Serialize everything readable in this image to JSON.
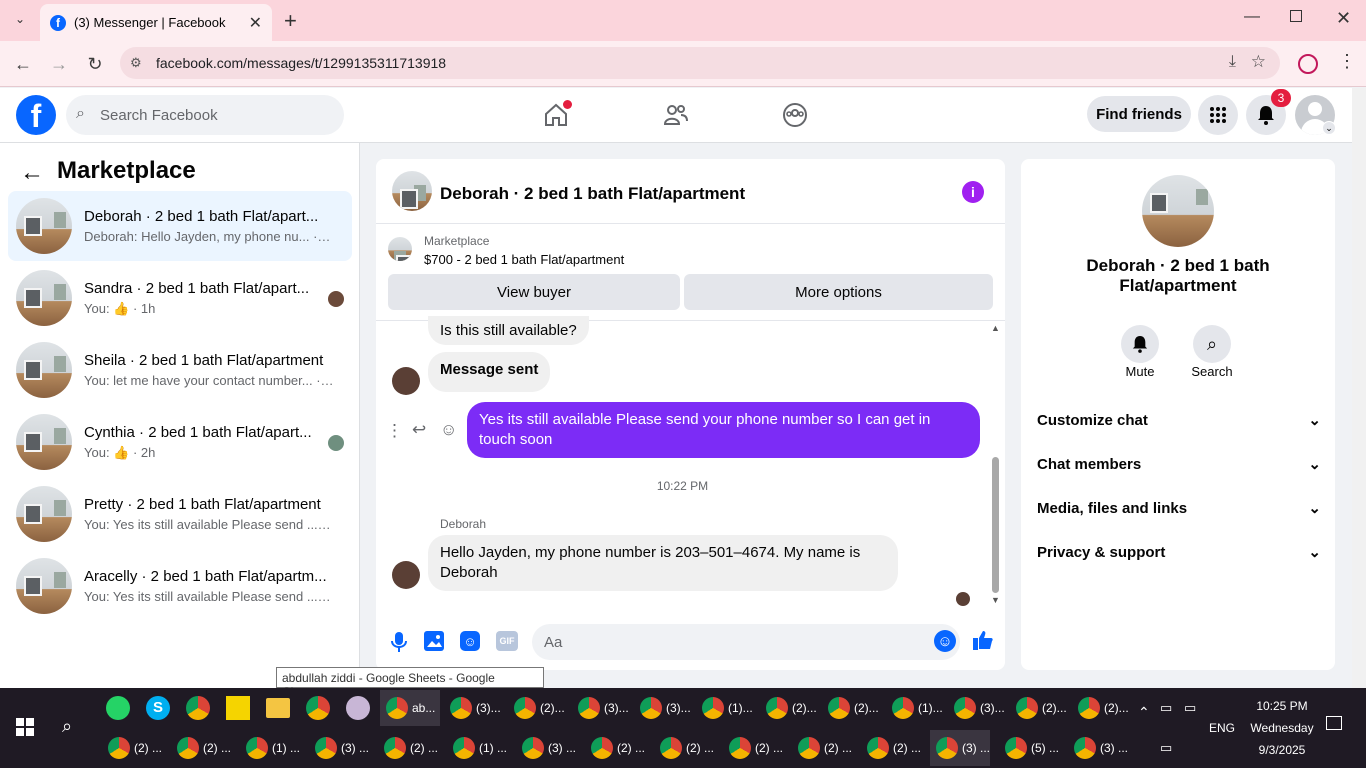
{
  "browser": {
    "tab_title": "(3) Messenger | Facebook",
    "url": "facebook.com/messages/t/1299135311713918"
  },
  "fb": {
    "search_placeholder": "Search Facebook",
    "find_friends": "Find friends",
    "notif_count": "3",
    "brand_color": "#0866ff"
  },
  "sidebar": {
    "title": "Marketplace",
    "conversations": [
      {
        "name": "Deborah · 2 bed 1 bath Flat/apart...",
        "preview": "Deborah: Hello Jayden, my phone nu... ·3m"
      },
      {
        "name": "Sandra · 2 bed 1 bath Flat/apart...",
        "preview": "You: 👍 · 1h"
      },
      {
        "name": "Sheila · 2 bed 1 bath Flat/apartment",
        "preview": "You: let me have your contact number... · 1h"
      },
      {
        "name": "Cynthia · 2 bed 1 bath Flat/apart...",
        "preview": "You: 👍 · 2h"
      },
      {
        "name": "Pretty · 2 bed 1 bath Flat/apartment",
        "preview": "You: Yes its still available Please send ... · 2h"
      },
      {
        "name": "Aracelly · 2 bed 1 bath Flat/apartm...",
        "preview": "You: Yes its still available Please send ... · 2h"
      }
    ]
  },
  "chat": {
    "title": "Deborah · 2 bed 1 bath Flat/apartment",
    "listing_label": "Marketplace",
    "listing_title": "$700 - 2 bed 1 bath Flat/apartment",
    "view_buyer": "View buyer",
    "more_options": "More options",
    "msg1": "Is this still available?",
    "msg2": "Message sent",
    "sent": "Yes its still available Please send your phone number so I can get in touch soon",
    "timestamp": "10:22 PM",
    "sender": "Deborah",
    "reply": "Hello Jayden, my phone number is 203–501–4674. My name is Deborah",
    "input_placeholder": "Aa",
    "sent_color": "#7c2cf6"
  },
  "details": {
    "name": "Deborah · 2 bed 1 bath Flat/apartment",
    "mute": "Mute",
    "search": "Search",
    "sections": [
      "Customize chat",
      "Chat members",
      "Media, files and links",
      "Privacy & support"
    ]
  },
  "tooltip": "abdullah ziddi - Google Sheets - Google Chrome",
  "taskbar": {
    "row1": [
      "ab...",
      "(3)...",
      "(2)...",
      "(3)...",
      "(3)...",
      "(1)...",
      "(2)...",
      "(2)...",
      "(1)...",
      "(3)...",
      "(2)...",
      "(2)..."
    ],
    "row2": [
      "(2) ...",
      "(2) ...",
      "(1) ...",
      "(3) ...",
      "(2) ...",
      "(1) ...",
      "(3) ...",
      "(2) ...",
      "(2) ...",
      "(2) ...",
      "(2) ...",
      "(2) ...",
      "(3) ...",
      "(5) ...",
      "(3) ..."
    ],
    "lang": "ENG",
    "time": "10:25 PM",
    "day": "Wednesday",
    "date": "9/3/2025"
  }
}
